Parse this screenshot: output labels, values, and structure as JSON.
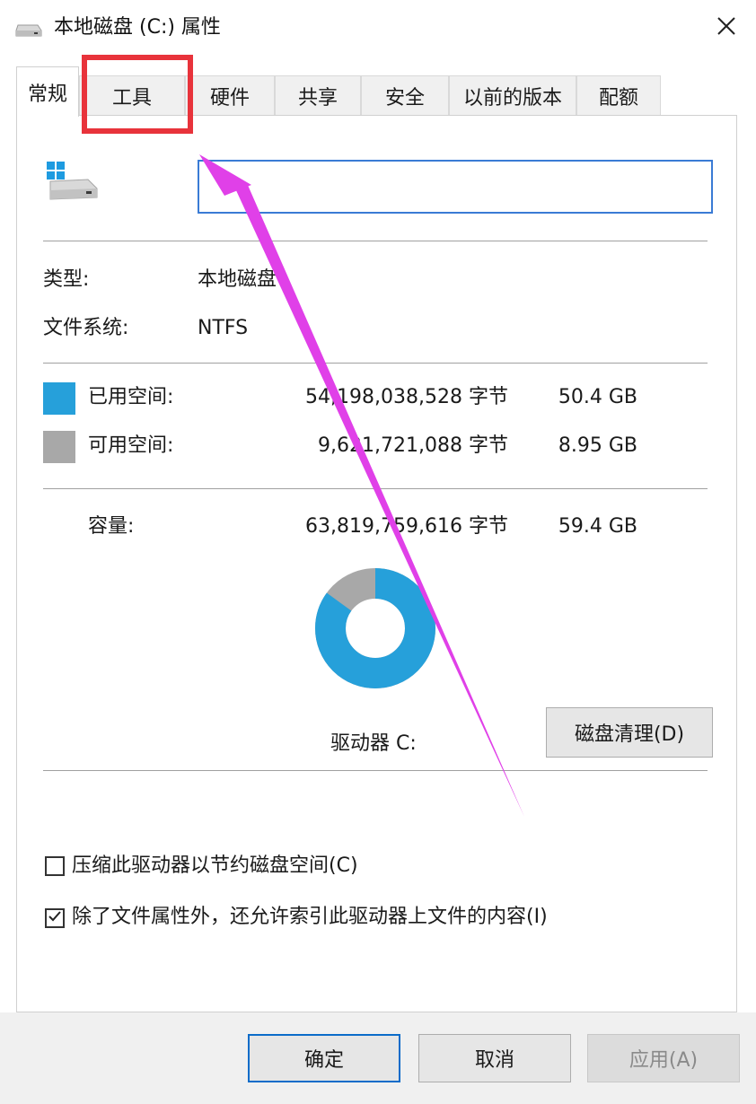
{
  "window": {
    "title": "本地磁盘 (C:) 属性",
    "title_icon": "drive-icon",
    "close_glyph": "✕"
  },
  "tabs": [
    {
      "label": "常规",
      "active": true
    },
    {
      "label": "工具",
      "active": false
    },
    {
      "label": "硬件",
      "active": false
    },
    {
      "label": "共享",
      "active": false
    },
    {
      "label": "安全",
      "active": false
    },
    {
      "label": "以前的版本",
      "active": false
    },
    {
      "label": "配额",
      "active": false
    }
  ],
  "general": {
    "drive_icon": "windows-drive-icon",
    "name_value": "",
    "type_label": "类型:",
    "type_value": "本地磁盘",
    "fs_label": "文件系统:",
    "fs_value": "NTFS",
    "used_label": "已用空间:",
    "used_bytes": "54,198,038,528 字节",
    "used_size": "50.4 GB",
    "used_color": "#26a0da",
    "free_label": "可用空间:",
    "free_bytes": "9,621,721,088 字节",
    "free_size": "8.95 GB",
    "free_color": "#a8a8a8",
    "capacity_label": "容量:",
    "capacity_bytes": "63,819,759,616 字节",
    "capacity_size": "59.4 GB",
    "used_fraction": 0.849,
    "drive_label": "驱动器 C:",
    "cleanup_button": "磁盘清理(D)",
    "compress_checkbox": {
      "label": "压缩此驱动器以节约磁盘空间(C)",
      "checked": false
    },
    "index_checkbox": {
      "label": "除了文件属性外，还允许索引此驱动器上文件的内容(I)",
      "checked": true
    }
  },
  "buttons": {
    "ok": "确定",
    "cancel": "取消",
    "apply": "应用(A)"
  },
  "annotations": {
    "highlight_color": "#e8333b",
    "arrow_color": "#e040e8"
  }
}
